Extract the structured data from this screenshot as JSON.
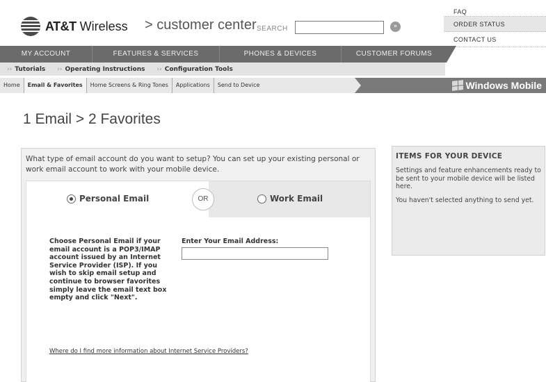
{
  "header": {
    "logo_bold": "AT&T",
    "logo_rest": "Wireless",
    "subtitle": "> customer center",
    "search_label": "SEARCH",
    "search_value": "",
    "search_go_icon": "go-arrow-icon",
    "quick_links": [
      "FAQ",
      "ORDER STATUS",
      "CONTACT US"
    ]
  },
  "main_nav": [
    "MY ACCOUNT",
    "FEATURES & SERVICES",
    "PHONES & DEVICES",
    "CUSTOMER FORUMS"
  ],
  "sub_nav": [
    {
      "arrow": "››",
      "label": "Tutorials"
    },
    {
      "arrow": "››",
      "label": "Operating Instructions"
    },
    {
      "arrow": "››",
      "label": "Configuration Tools"
    }
  ],
  "crumbs": [
    "Home",
    "Email & Favorites",
    "Home Screens & Ring Tones",
    "Applications",
    "Send to Device"
  ],
  "brand_right": "Windows Mobile",
  "page_title": "1 Email  >  2 Favorites",
  "form": {
    "intro": "What type of email account do you want to setup? You can set up your existing personal or work email account to work with your mobile device.",
    "option_personal": "Personal Email",
    "option_or": "OR",
    "option_work": "Work Email",
    "selected": "Personal Email",
    "help_text": "Choose Personal Email if your email account is a POP3/IMAP account issued by an Internet Service Provider (ISP). If you wish to skip email setup and continue to browser favorites simply leave the email text box empty and click \"Next\".",
    "email_label": "Enter Your Email Address:",
    "email_value": "",
    "isp_link": "Where do I find more information about Internet Service Providers?"
  },
  "side_panel": {
    "title": "ITEMS FOR YOUR DEVICE",
    "text1": "Settings and feature enhancements ready to be sent to your mobile device will be listed here.",
    "text2": "You haven't selected anything to send yet."
  }
}
